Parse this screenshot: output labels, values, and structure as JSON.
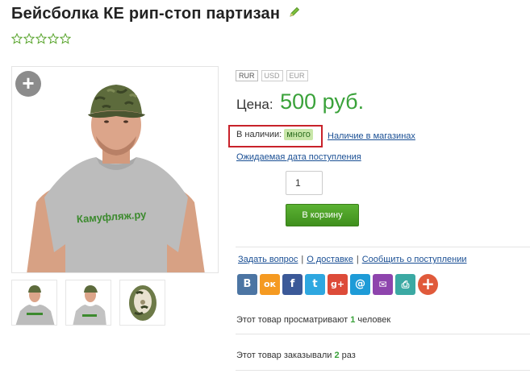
{
  "product": {
    "title": "Бейсболка КЕ рип-стоп партизан",
    "rating": 0,
    "rating_max": 5
  },
  "currencies": [
    {
      "code": "RUR",
      "active": true
    },
    {
      "code": "USD",
      "active": false
    },
    {
      "code": "EUR",
      "active": false
    }
  ],
  "price": {
    "label": "Цена:",
    "value": "500 руб."
  },
  "stock": {
    "label": "В наличии:",
    "value": "много",
    "stores_link": "Наличие в магазинах"
  },
  "expected_link": "Ожидаемая дата поступления",
  "quantity": "1",
  "cart_button": "В корзину",
  "links": {
    "ask": "Задать вопрос",
    "delivery": "О доставке",
    "notify": "Сообщить о поступлении"
  },
  "social_buttons": [
    {
      "name": "vkontakte-icon",
      "glyph": "В",
      "color": "#4c75a3"
    },
    {
      "name": "odnoklassniki-icon",
      "glyph": "ок",
      "color": "#f59a21"
    },
    {
      "name": "facebook-icon",
      "glyph": "f",
      "color": "#3b5998"
    },
    {
      "name": "twitter-icon",
      "glyph": "t",
      "color": "#2ea7e0"
    },
    {
      "name": "google-plus-icon",
      "glyph": "g+",
      "color": "#dd4b39"
    },
    {
      "name": "email-at-icon",
      "glyph": "@",
      "color": "#1e9bd7"
    },
    {
      "name": "mail-icon",
      "glyph": "✉",
      "color": "#8e44ad"
    },
    {
      "name": "print-icon",
      "glyph": "⎙",
      "color": "#3ba9a3"
    },
    {
      "name": "more-plus-icon",
      "glyph": "+",
      "color": "#e05a3b"
    }
  ],
  "views": {
    "prefix": "Этот товар просматривают",
    "count": "1",
    "suffix": "человек"
  },
  "orders": {
    "prefix": "Этот товар заказывали",
    "count": "2",
    "suffix": "раз"
  },
  "colors": {
    "price": "#3aa23a",
    "link": "#1a4f94",
    "stock_highlight": "#c8222a",
    "cart_button": "#4aa12a"
  }
}
